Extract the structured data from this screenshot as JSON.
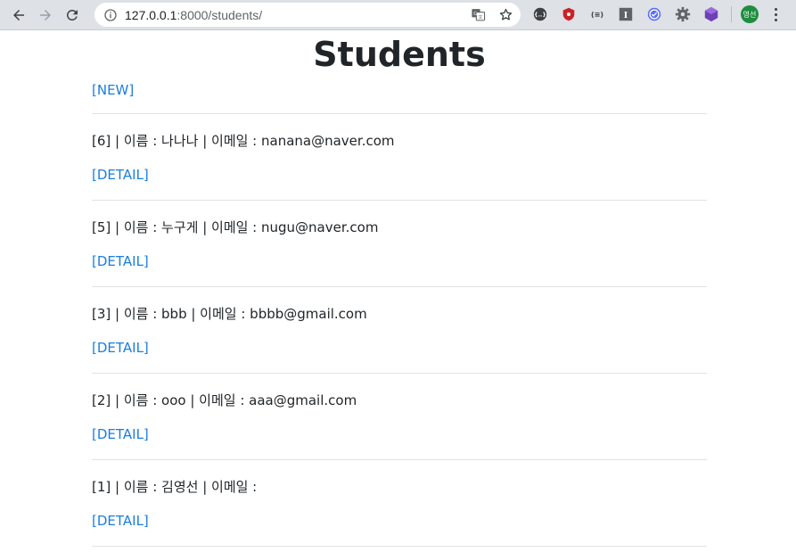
{
  "browser": {
    "url_host": "127.0.0.1",
    "url_path": ":8000/students/",
    "profile_label": "영선",
    "extensions": [
      "{..}",
      "(≡)",
      "I"
    ]
  },
  "page": {
    "title": "Students",
    "new_link": "[NEW]",
    "students": [
      {
        "info": "[6] | 이름 : 나나나 | 이메일 : nanana@naver.com",
        "detail": "[DETAIL]"
      },
      {
        "info": "[5] | 이름 : 누구게 | 이메일 : nugu@naver.com",
        "detail": "[DETAIL]"
      },
      {
        "info": "[3] | 이름 : bbb | 이메일 : bbbb@gmail.com",
        "detail": "[DETAIL]"
      },
      {
        "info": "[2] | 이름 : ooo | 이메일 : aaa@gmail.com",
        "detail": "[DETAIL]"
      },
      {
        "info": "[1] | 이름 : 김영선 | 이메일 :",
        "detail": "[DETAIL]"
      }
    ]
  },
  "colors": {
    "link": "#1a7ee0",
    "text": "#212529",
    "chrome": "#dee1e6"
  }
}
